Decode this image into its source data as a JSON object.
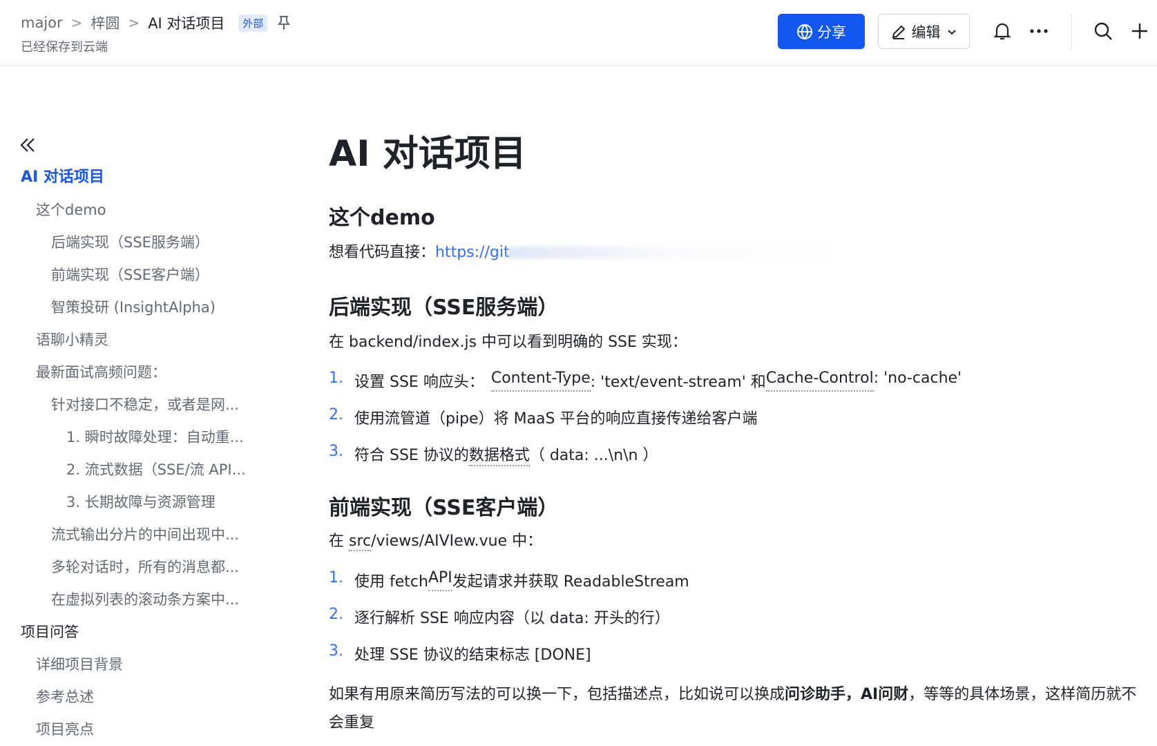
{
  "header": {
    "breadcrumb": [
      "major",
      "梓圆",
      "AI 对话项目"
    ],
    "badge": "外部",
    "save_status": "已经保存到云端",
    "share_label": "分享",
    "edit_label": "编辑",
    "icons": [
      "pin-icon",
      "globe-icon",
      "pencil-icon",
      "chevron-down-icon",
      "bell-icon",
      "more-icon",
      "search-icon",
      "plus-icon"
    ]
  },
  "colors": {
    "accent": "#1456f0",
    "link": "#3370ff",
    "text": "#1f2329",
    "muted": "#646a73"
  },
  "toc": [
    {
      "label": "AI 对话项目",
      "level": 0,
      "active": true
    },
    {
      "label": "这个demo",
      "level": 1
    },
    {
      "label": "后端实现（SSE服务端）",
      "level": 2
    },
    {
      "label": "前端实现（SSE客户端）",
      "level": 2
    },
    {
      "label": "智策投研 (InsightAlpha)",
      "level": 2
    },
    {
      "label": "语聊小精灵",
      "level": 1
    },
    {
      "label": "最新面试高频问题：",
      "level": 1
    },
    {
      "label": "针对接口不稳定，或者是网...",
      "level": 2
    },
    {
      "label": "1. 瞬时故障处理：自动重...",
      "level": 3
    },
    {
      "label": "2. 流式数据（SSE/流 API...",
      "level": 3
    },
    {
      "label": "3. 长期故障与资源管理",
      "level": 3
    },
    {
      "label": "流式输出分片的中间出现中...",
      "level": 2
    },
    {
      "label": "多轮对话时，所有的消息都...",
      "level": 2
    },
    {
      "label": "在虚拟列表的滚动条方案中...",
      "level": 2
    },
    {
      "label": "项目问答",
      "level": 0
    },
    {
      "label": "详细项目背景",
      "level": 1
    },
    {
      "label": "参考总述",
      "level": 1
    },
    {
      "label": "项目亮点",
      "level": 1
    }
  ],
  "doc": {
    "title": "AI 对话项目",
    "section_demo": {
      "heading": "这个demo",
      "text": "想看代码直接：",
      "link": "https://git"
    },
    "section_backend": {
      "heading": "后端实现（SSE服务端）",
      "intro": "在 backend/index.js 中可以看到明确的 SSE 实现：",
      "items": [
        {
          "num": "1.",
          "a": "设置 SSE 响应头：",
          "b": "Content-Type",
          "c": ": 'text/event-stream' 和 ",
          "d": "Cache-Control",
          "e": ": 'no-cache'"
        },
        {
          "num": "2.",
          "text": "使用流管道（pipe）将 MaaS 平台的响应直接传递给客户端"
        },
        {
          "num": "3.",
          "a": "符合 SSE 协议的",
          "b": "数据格式",
          "c": "（ data: ...\\n\\n ）"
        }
      ]
    },
    "section_frontend": {
      "heading": "前端实现（SSE客户端）",
      "intro_a": "在 ",
      "intro_b": "src",
      "intro_c": "/views/AIVIew.vue 中：",
      "items": [
        {
          "num": "1.",
          "a": "使用 fetch ",
          "b": "API",
          "c": " 发起请求并获取 ReadableStream"
        },
        {
          "num": "2.",
          "text": "逐行解析 SSE 响应内容（以 data: 开头的行）"
        },
        {
          "num": "3.",
          "text": "处理 SSE 协议的结束标志 [DONE]"
        }
      ]
    },
    "closing": {
      "a": "如果有用原来简历写法的可以换一下，包括描述点，比如说可以换成",
      "b": "问诊助手，AI问财",
      "c": "，等等的具体场景，这样简历就不会重复"
    }
  }
}
